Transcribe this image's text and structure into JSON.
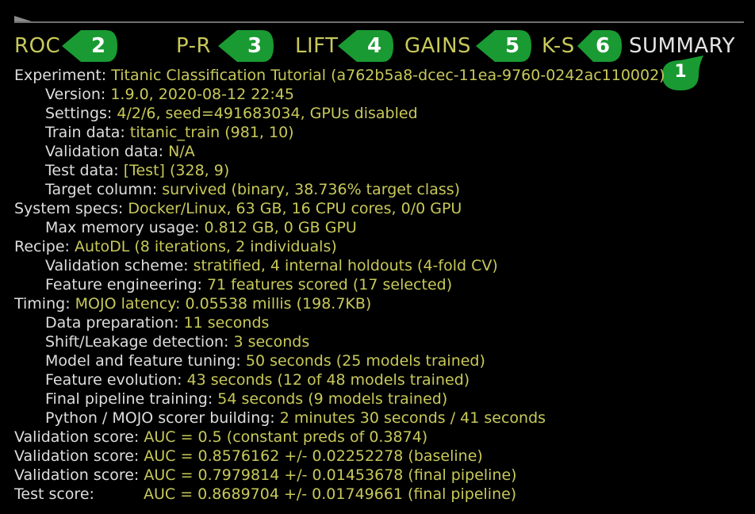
{
  "tabs": [
    {
      "id": "roc",
      "label": "ROC",
      "badge": "2"
    },
    {
      "id": "pr",
      "label": "P-R",
      "badge": "3"
    },
    {
      "id": "lift",
      "label": "LIFT",
      "badge": "4"
    },
    {
      "id": "gains",
      "label": "GAINS",
      "badge": "5"
    },
    {
      "id": "ks",
      "label": "K-S",
      "badge": "6"
    },
    {
      "id": "summary",
      "label": "SUMMARY",
      "badge": "1",
      "active": true
    }
  ],
  "colors": {
    "accent_text": "#c8c95a",
    "label_text": "#dedede",
    "badge_green": "#1a9a32",
    "background": "#000000"
  },
  "summary": [
    {
      "label": "Experiment: ",
      "value": "Titanic Classification Tutorial (a762b5a8-dcec-11ea-9760-0242ac110002)",
      "indent": false
    },
    {
      "label": "Version: ",
      "value": "1.9.0, 2020-08-12 22:45",
      "indent": true
    },
    {
      "label": "Settings: ",
      "value": "4/2/6, seed=491683034, GPUs disabled",
      "indent": true
    },
    {
      "label": "Train data: ",
      "value": "titanic_train (981, 10)",
      "indent": true
    },
    {
      "label": "Validation data: ",
      "value": "N/A",
      "indent": true
    },
    {
      "label": "Test data: ",
      "value": "[Test] (328, 9)",
      "indent": true
    },
    {
      "label": "Target column: ",
      "value": "survived (binary, 38.736% target class)",
      "indent": true
    },
    {
      "label": "System specs: ",
      "value": "Docker/Linux, 63 GB, 16 CPU cores, 0/0 GPU",
      "indent": false
    },
    {
      "label": "Max memory usage: ",
      "value": "0.812 GB, 0 GB GPU",
      "indent": true
    },
    {
      "label": "Recipe: ",
      "value": "AutoDL (8 iterations, 2 individuals)",
      "indent": false
    },
    {
      "label": "Validation scheme: ",
      "value": "stratified, 4 internal holdouts (4-fold CV)",
      "indent": true
    },
    {
      "label": "Feature engineering: ",
      "value": "71 features scored (17 selected)",
      "indent": true
    },
    {
      "label": "Timing: ",
      "value": "MOJO latency: 0.05538 millis (198.7KB)",
      "indent": false
    },
    {
      "label": "Data preparation: ",
      "value": "11 seconds",
      "indent": true
    },
    {
      "label": "Shift/Leakage detection: ",
      "value": "3 seconds",
      "indent": true
    },
    {
      "label": "Model and feature tuning: ",
      "value": "50 seconds (25 models trained)",
      "indent": true
    },
    {
      "label": "Feature evolution: ",
      "value": "43 seconds (12 of 48 models trained)",
      "indent": true
    },
    {
      "label": "Final pipeline training: ",
      "value": "54 seconds (9 models trained)",
      "indent": true
    },
    {
      "label": "Python / MOJO scorer building: ",
      "value": "2 minutes 30 seconds / 41 seconds",
      "indent": true
    },
    {
      "label": "Validation score: ",
      "value": "AUC = 0.5 (constant preds of 0.3874)",
      "indent": false
    },
    {
      "label": "Validation score: ",
      "value": "AUC = 0.8576162 +/- 0.02252278 (baseline)",
      "indent": false
    },
    {
      "label": "Validation score: ",
      "value": "AUC = 0.7979814 +/- 0.01453678 (final pipeline)",
      "indent": false
    },
    {
      "label": "Test score:",
      "value": "AUC = 0.8689704 +/- 0.01749661 (final pipeline)",
      "indent": false,
      "padded": true
    }
  ]
}
